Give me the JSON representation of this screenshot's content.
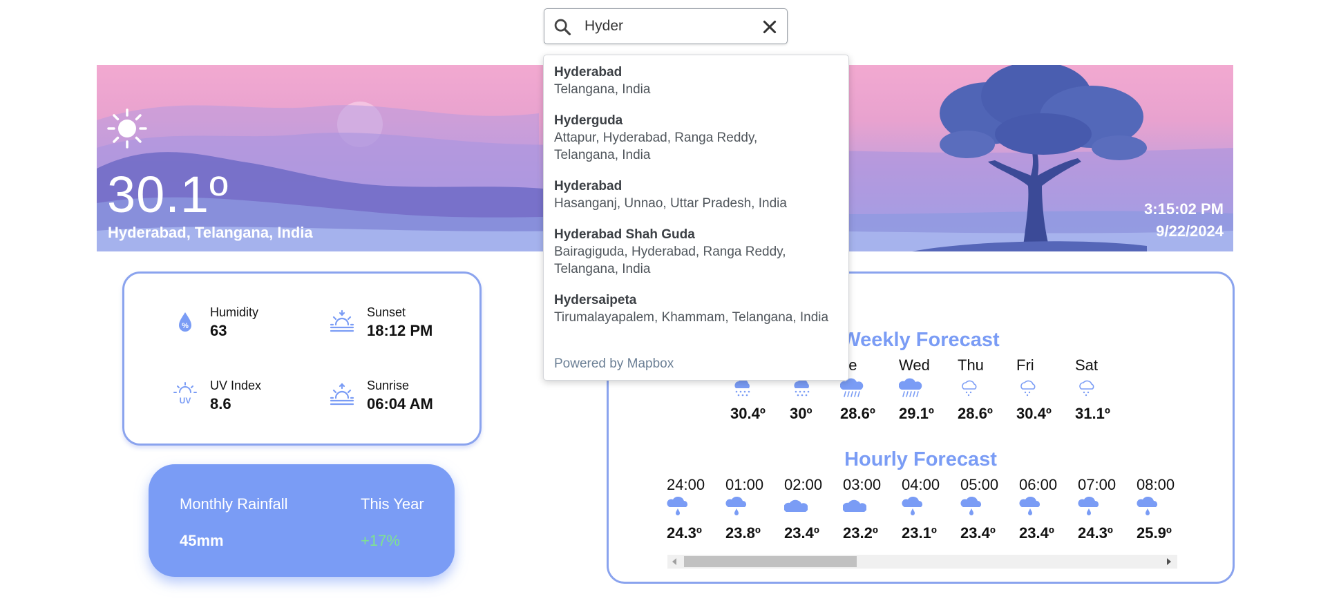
{
  "search": {
    "value": "Hyder",
    "suggestions": [
      {
        "name": "Hyderabad",
        "address": "Telangana, India"
      },
      {
        "name": "Hyderguda",
        "address": "Attapur, Hyderabad, Ranga Reddy, Telangana, India"
      },
      {
        "name": "Hyderabad",
        "address": "Hasanganj, Unnao, Uttar Pradesh, India"
      },
      {
        "name": "Hyderabad Shah Guda",
        "address": "Bairagiguda, Hyderabad, Ranga Reddy, Telangana, India"
      },
      {
        "name": "Hydersaipeta",
        "address": "Tirumalayapalem, Khammam, Telangana, India"
      }
    ],
    "powered_by": "Powered by Mapbox"
  },
  "current": {
    "icon": "sun-icon",
    "temperature": "30.1º",
    "location": "Hyderabad, Telangana, India",
    "time": "3:15:02 PM",
    "date": "9/22/2024"
  },
  "stats": {
    "humidity": {
      "label": "Humidity",
      "value": "63",
      "icon": "humidity-icon"
    },
    "sunset": {
      "label": "Sunset",
      "value": "18:12 PM",
      "icon": "sunset-icon"
    },
    "uv": {
      "label": "UV Index",
      "value": "8.6",
      "icon": "uv-icon"
    },
    "sunrise": {
      "label": "Sunrise",
      "value": "06:04 AM",
      "icon": "sunrise-icon"
    }
  },
  "rainfall": {
    "label": "Monthly Rainfall",
    "period": "This Year",
    "value": "45mm",
    "change": "+17%",
    "change_color": "#7fe38e"
  },
  "weekly": {
    "title": "Weekly Forecast",
    "days": [
      {
        "day": "",
        "icon": "snow-icon",
        "temp": "30.4º"
      },
      {
        "day": "",
        "icon": "snow-icon",
        "temp": "30º"
      },
      {
        "day": "ue",
        "icon": "rain-heavy-icon",
        "temp": "28.6º"
      },
      {
        "day": "Wed",
        "icon": "rain-heavy-icon",
        "temp": "29.1º"
      },
      {
        "day": "Thu",
        "icon": "snow-light-icon",
        "temp": "28.6º"
      },
      {
        "day": "Fri",
        "icon": "snow-light-icon",
        "temp": "30.4º"
      },
      {
        "day": "Sat",
        "icon": "snow-light-icon",
        "temp": "31.1º"
      }
    ]
  },
  "hourly": {
    "title": "Hourly Forecast",
    "hours": [
      {
        "hour": "24:00",
        "icon": "rain-drop-icon",
        "temp": "24.3º"
      },
      {
        "hour": "01:00",
        "icon": "rain-drop-icon",
        "temp": "23.8º"
      },
      {
        "hour": "02:00",
        "icon": "cloud-icon",
        "temp": "23.4º"
      },
      {
        "hour": "03:00",
        "icon": "cloud-icon",
        "temp": "23.2º"
      },
      {
        "hour": "04:00",
        "icon": "rain-drop-icon",
        "temp": "23.1º"
      },
      {
        "hour": "05:00",
        "icon": "rain-drop-icon",
        "temp": "23.4º"
      },
      {
        "hour": "06:00",
        "icon": "rain-drop-icon",
        "temp": "23.4º"
      },
      {
        "hour": "07:00",
        "icon": "rain-drop-icon",
        "temp": "24.3º"
      },
      {
        "hour": "08:00",
        "icon": "rain-drop-icon",
        "temp": "25.9º"
      }
    ]
  },
  "colors": {
    "accent": "#7a9cf5",
    "card_border": "#8aa3ee"
  }
}
